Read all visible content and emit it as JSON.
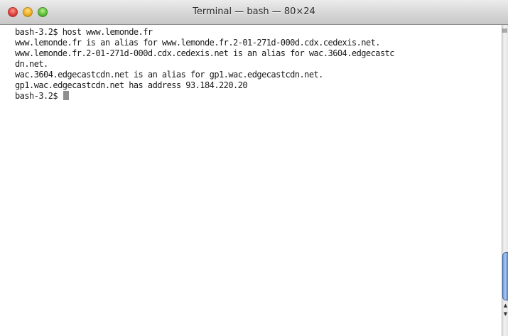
{
  "window": {
    "title": "Terminal — bash — 80×24"
  },
  "terminal": {
    "lines": [
      "bash-3.2$ host www.lemonde.fr",
      "www.lemonde.fr is an alias for www.lemonde.fr.2-01-271d-000d.cdx.cedexis.net.",
      "www.lemonde.fr.2-01-271d-000d.cdx.cedexis.net is an alias for wac.3604.edgecastc",
      "dn.net.",
      "wac.3604.edgecastcdn.net is an alias for gp1.wac.edgecastcdn.net.",
      "gp1.wac.edgecastcdn.net has address 93.184.220.20"
    ],
    "prompt": "bash-3.2$ "
  },
  "icons": {
    "close": "close-button-icon",
    "minimize": "minimize-button-icon",
    "zoom": "zoom-button-icon",
    "split": "split-pane-icon",
    "scroll_up": "scroll-up-arrow-icon",
    "scroll_down": "scroll-down-arrow-icon"
  },
  "colors": {
    "close": "#e0443e",
    "minimize": "#f0b020",
    "zoom": "#5fc23a",
    "scroll_thumb": "#6f9bd8",
    "cursor": "#8f8f8f"
  }
}
